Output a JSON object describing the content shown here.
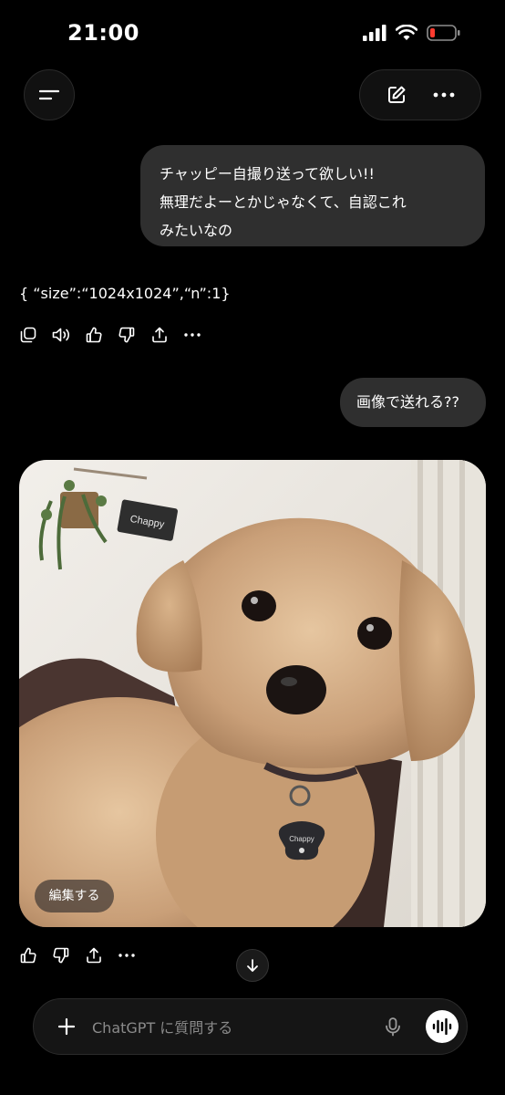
{
  "status_bar": {
    "time": "21:00",
    "battery_color": "#ff3b30"
  },
  "header": {
    "menu_icon": "menu-icon",
    "new_chat_icon": "edit-icon",
    "more_icon": "more-icon"
  },
  "messages": {
    "user_1": {
      "lines": [
        "チャッピー自撮り送って欲しい!!",
        "無理だよーとかじゃなくて、自認これ",
        "みたいなの"
      ]
    },
    "assistant_1": {
      "text": "{ “size”:“1024x1024”,“n”:1}"
    },
    "user_2": {
      "text": "画像で送れる??"
    },
    "assistant_2": {
      "image_alt": "Chappy",
      "tag_text": "Chappy",
      "sign_text": "Chappy",
      "edit_label": "編集する"
    }
  },
  "actions_1": [
    "copy-icon",
    "speaker-icon",
    "thumbs-up-icon",
    "thumbs-down-icon",
    "share-icon",
    "more-icon"
  ],
  "actions_2": [
    "thumbs-up-icon",
    "thumbs-down-icon",
    "share-icon",
    "more-icon"
  ],
  "composer": {
    "placeholder": "ChatGPT に質問する"
  }
}
